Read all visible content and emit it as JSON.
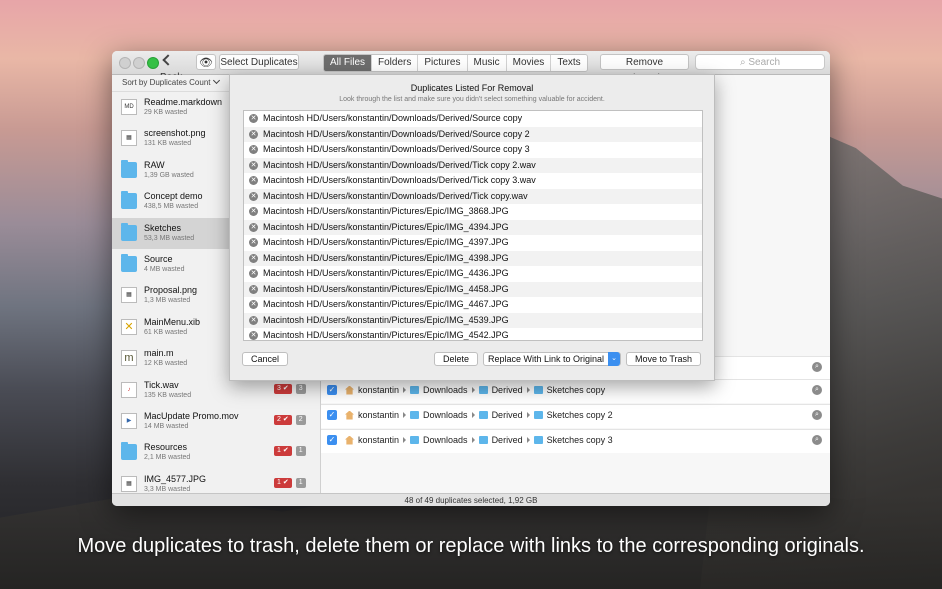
{
  "toolbar": {
    "back_label": "Back",
    "select_duplicates": "Select Duplicates",
    "tabs": [
      "All Files",
      "Folders",
      "Pictures",
      "Music",
      "Movies",
      "Texts"
    ],
    "remove_selected": "Remove Selected...",
    "search_placeholder": "Search"
  },
  "sidebar": {
    "sort_label": "Sort by Duplicates Count",
    "items": [
      {
        "name": "Readme.markdown",
        "size": "29 KB wasted",
        "icon": "markdown-doc-icon"
      },
      {
        "name": "screenshot.png",
        "size": "131 KB wasted",
        "icon": "image-doc-icon"
      },
      {
        "name": "RAW",
        "size": "1,39 GB wasted",
        "icon": "folder-icon"
      },
      {
        "name": "Concept demo",
        "size": "438,5 MB wasted",
        "icon": "folder-icon"
      },
      {
        "name": "Sketches",
        "size": "53,3 MB wasted",
        "icon": "folder-icon"
      },
      {
        "name": "Source",
        "size": "4 MB wasted",
        "icon": "folder-icon"
      },
      {
        "name": "Proposal.png",
        "size": "1,3 MB wasted",
        "icon": "image-doc-icon"
      },
      {
        "name": "MainMenu.xib",
        "size": "61 KB wasted",
        "icon": "xib-icon"
      },
      {
        "name": "main.m",
        "size": "12 KB wasted",
        "icon": "objc-icon"
      },
      {
        "name": "Tick.wav",
        "size": "135 KB wasted",
        "icon": "audio-icon",
        "red": "3 ✔",
        "grey": "3"
      },
      {
        "name": "MacUpdate Promo.mov",
        "size": "14 MB wasted",
        "icon": "movie-icon",
        "red": "2 ✔",
        "grey": "2"
      },
      {
        "name": "Resources",
        "size": "2,1 MB wasted",
        "icon": "folder-icon",
        "red": "1 ✔",
        "grey": "1"
      },
      {
        "name": "IMG_4577.JPG",
        "size": "3,3 MB wasted",
        "icon": "image-doc-icon",
        "red": "1 ✔",
        "grey": "1"
      }
    ]
  },
  "paths": [
    {
      "crumbs": [
        "konstantin",
        "Downloads",
        "Derived",
        "Sketches copy"
      ]
    },
    {
      "crumbs": [
        "konstantin",
        "Downloads",
        "Derived",
        "Sketches copy 2"
      ]
    },
    {
      "crumbs": [
        "konstantin",
        "Downloads",
        "Derived",
        "Sketches copy 3"
      ]
    }
  ],
  "status": "48 of 49 duplicates selected, 1,92 GB",
  "sheet": {
    "title": "Duplicates Listed For Removal",
    "subtitle": "Look through the list and make sure you didn't select something valuable for accident.",
    "items": [
      "Macintosh HD/Users/konstantin/Downloads/Derived/Source copy",
      "Macintosh HD/Users/konstantin/Downloads/Derived/Source copy 2",
      "Macintosh HD/Users/konstantin/Downloads/Derived/Source copy 3",
      "Macintosh HD/Users/konstantin/Downloads/Derived/Tick copy 2.wav",
      "Macintosh HD/Users/konstantin/Downloads/Derived/Tick copy 3.wav",
      "Macintosh HD/Users/konstantin/Downloads/Derived/Tick copy.wav",
      "Macintosh HD/Users/konstantin/Pictures/Epic/IMG_3868.JPG",
      "Macintosh HD/Users/konstantin/Pictures/Epic/IMG_4394.JPG",
      "Macintosh HD/Users/konstantin/Pictures/Epic/IMG_4397.JPG",
      "Macintosh HD/Users/konstantin/Pictures/Epic/IMG_4398.JPG",
      "Macintosh HD/Users/konstantin/Pictures/Epic/IMG_4436.JPG",
      "Macintosh HD/Users/konstantin/Pictures/Epic/IMG_4458.JPG",
      "Macintosh HD/Users/konstantin/Pictures/Epic/IMG_4467.JPG",
      "Macintosh HD/Users/konstantin/Pictures/Epic/IMG_4539.JPG",
      "Macintosh HD/Users/konstantin/Pictures/Epic/IMG_4542.JPG"
    ],
    "cancel": "Cancel",
    "delete": "Delete",
    "replace": "Replace With Link to Original",
    "trash": "Move to Trash"
  },
  "caption": "Move duplicates to trash, delete them or replace with links to the corresponding originals."
}
